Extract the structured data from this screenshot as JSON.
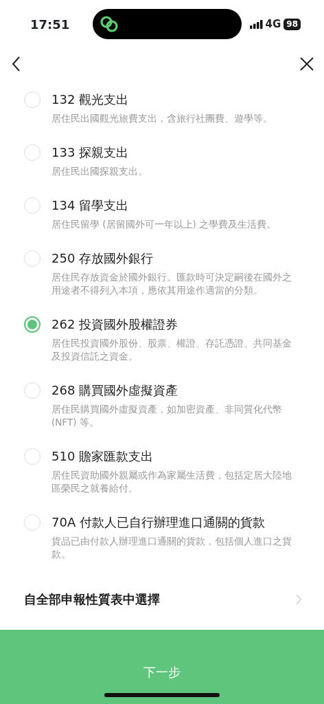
{
  "status_bar": {
    "time": "17:51",
    "network": "4G",
    "battery": "98"
  },
  "options": [
    {
      "title": "132 觀光支出",
      "description": "居住民出國觀光旅費支出，含旅行社團費、遊學等。",
      "selected": false
    },
    {
      "title": "133 探親支出",
      "description": "居住民出國探親支出。",
      "selected": false
    },
    {
      "title": "134 留學支出",
      "description": "居住民留學 (居留國外可一年以上) 之學費及生活費。",
      "selected": false
    },
    {
      "title": "250 存放國外銀行",
      "description": "居住民存放資金於國外銀行。匯款時可決定嗣後在國外之用途者不得列入本項，應依其用途作適當的分類。",
      "selected": false
    },
    {
      "title": "262 投資國外股權證券",
      "description": "居住民投資國外股份、股票、權證、存託憑證、共同基金及投資信託之資金。",
      "selected": true
    },
    {
      "title": "268 購買國外虛擬資產",
      "description": "居住民購買國外虛擬資產，如加密資產、非同質化代幣 (NFT) 等。",
      "selected": false
    },
    {
      "title": "510 贍家匯款支出",
      "description": "居住民資助國外親屬或作為家屬生活費，包括定居大陸地區榮民之就養給付。",
      "selected": false
    },
    {
      "title": "70A 付款人已自行辦理進口通關的貨款",
      "description": "貨品已由付款人辦理進口通關的貨款，包括個人進口之貨款。",
      "selected": false
    }
  ],
  "all_categories_link": "自全部申報性質表中選擇",
  "next_button": "下一步"
}
